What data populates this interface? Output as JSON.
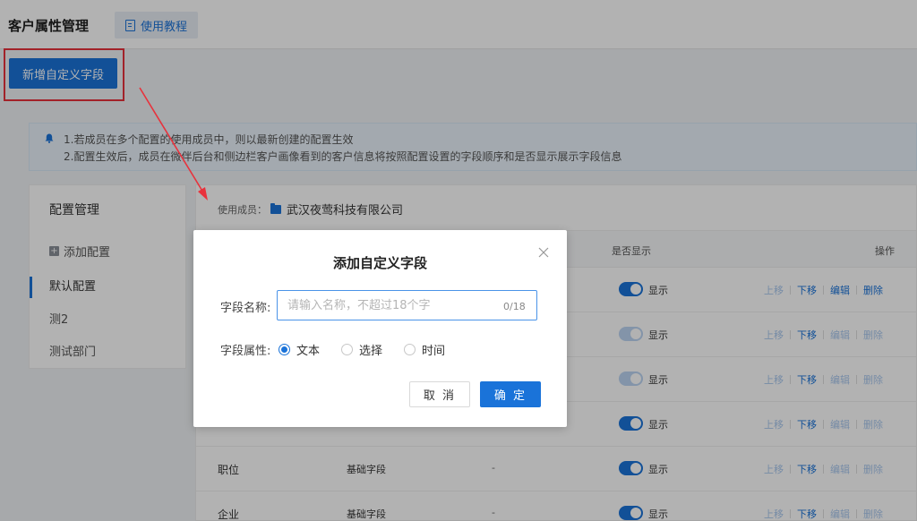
{
  "header": {
    "title": "客户属性管理",
    "tutorial_tab": "使用教程"
  },
  "toolbar": {
    "add_field_label": "新增自定义字段"
  },
  "notice": {
    "line1": "1.若成员在多个配置的使用成员中，则以最新创建的配置生效",
    "line2": "2.配置生效后，成员在微伴后台和侧边栏客户画像看到的客户信息将按照配置设置的字段顺序和是否显示展示字段信息"
  },
  "config": {
    "title": "配置管理",
    "add_label": "添加配置",
    "items": [
      {
        "label": "默认配置"
      },
      {
        "label": "测2"
      },
      {
        "label": "测试部门"
      }
    ]
  },
  "table": {
    "member_label": "使用成员：",
    "member_name": "武汉夜莺科技有限公司",
    "headers": {
      "show": "是否显示",
      "ops": "操作"
    },
    "show_text": "显示",
    "ops": {
      "up": "上移",
      "down": "下移",
      "edit": "编辑",
      "delete": "删除"
    },
    "rows": [
      {
        "name": "",
        "type": "",
        "value": "",
        "toggle": "on"
      },
      {
        "name": "",
        "type": "",
        "value": "",
        "toggle": "disabled"
      },
      {
        "name": "",
        "type": "",
        "value": "",
        "toggle": "disabled"
      },
      {
        "name": "",
        "type": "",
        "value": "",
        "toggle": "on"
      },
      {
        "name": "职位",
        "type": "基础字段",
        "value": "-",
        "toggle": "on"
      },
      {
        "name": "企业",
        "type": "基础字段",
        "value": "-",
        "toggle": "on"
      }
    ]
  },
  "dialog": {
    "title": "添加自定义字段",
    "field_name_label": "字段名称:",
    "field_name_placeholder": "请输入名称，不超过18个字",
    "field_name_value": "",
    "counter": "0/18",
    "attr_label": "字段属性:",
    "attr_options": [
      {
        "label": "文本",
        "checked": true
      },
      {
        "label": "选择",
        "checked": false
      },
      {
        "label": "时间",
        "checked": false
      }
    ],
    "cancel_label": "取 消",
    "confirm_label": "确 定"
  },
  "colors": {
    "primary": "#1a73d9",
    "annotation_red": "#e8323c"
  }
}
